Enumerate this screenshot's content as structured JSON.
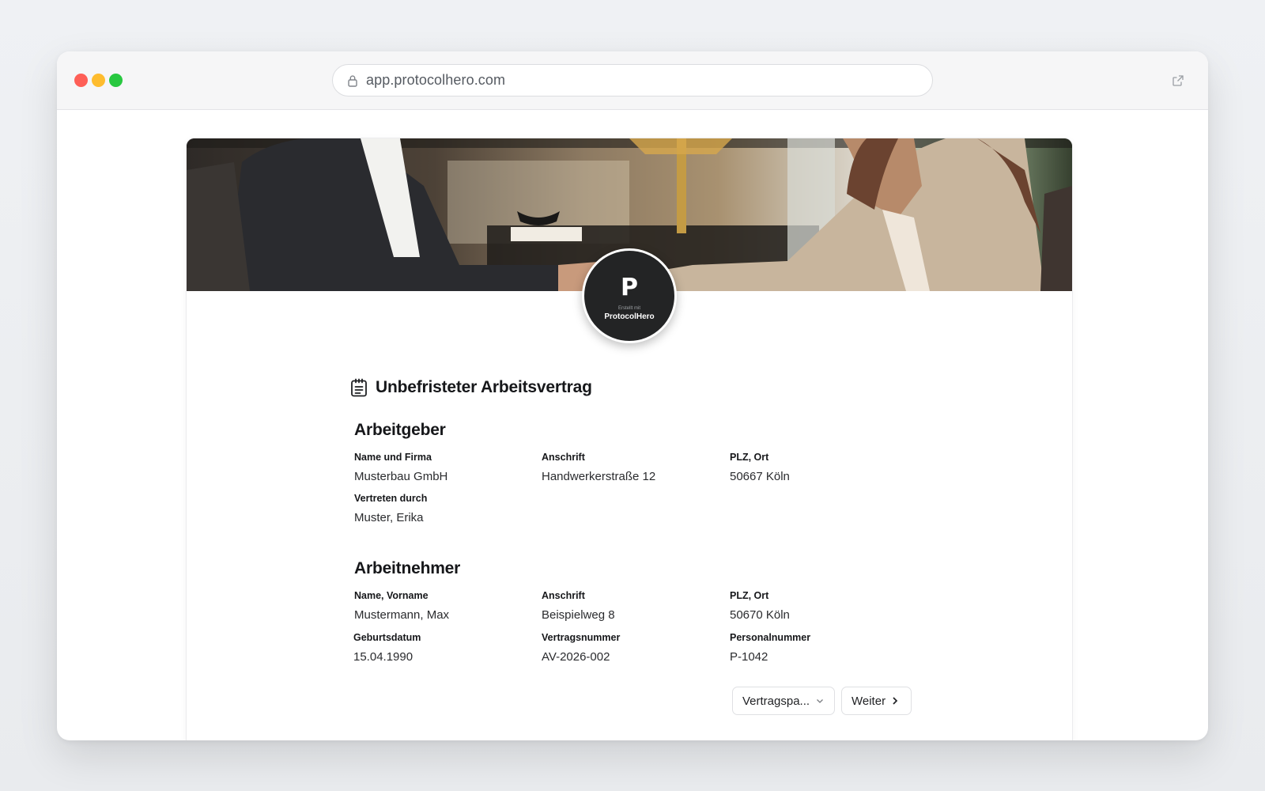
{
  "browser": {
    "url": "app.protocolhero.com"
  },
  "logo": {
    "mark": "P",
    "small_text": "Erstellt mit",
    "name": "ProtocolHero"
  },
  "document": {
    "title": "Unbefristeter Arbeitsvertrag"
  },
  "arbeitgeber": {
    "heading": "Arbeitgeber",
    "name_label": "Name und Firma",
    "name_value": "Musterbau GmbH",
    "address_label": "Anschrift",
    "address_value": "Handwerkerstraße 12",
    "city_label": "PLZ, Ort",
    "city_value": "50667 Köln",
    "rep_label": "Vertreten durch",
    "rep_value": "Muster, Erika"
  },
  "arbeitnehmer": {
    "heading": "Arbeitnehmer",
    "name_label": "Name, Vorname",
    "name_value": "Mustermann, Max",
    "address_label": "Anschrift",
    "address_value": "Beispielweg 8",
    "city_label": "PLZ, Ort",
    "city_value": "50670 Köln",
    "birth_label": "Geburtsdatum",
    "birth_value": "15.04.1990",
    "contract_label": "Vertragsnummer",
    "contract_value": "AV-2026-002",
    "personnel_label": "Personalnummer",
    "personnel_value": "P-1042"
  },
  "actions": {
    "dropdown_label": "Vertragspa...",
    "next_label": "Weiter"
  }
}
